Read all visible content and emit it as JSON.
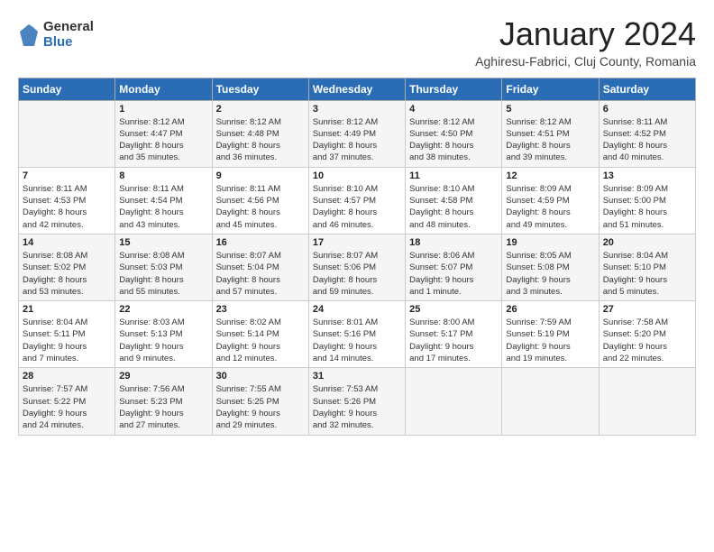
{
  "logo": {
    "general": "General",
    "blue": "Blue"
  },
  "title": "January 2024",
  "subtitle": "Aghiresu-Fabrici, Cluj County, Romania",
  "headers": [
    "Sunday",
    "Monday",
    "Tuesday",
    "Wednesday",
    "Thursday",
    "Friday",
    "Saturday"
  ],
  "weeks": [
    [
      {
        "day": "",
        "info": ""
      },
      {
        "day": "1",
        "info": "Sunrise: 8:12 AM\nSunset: 4:47 PM\nDaylight: 8 hours\nand 35 minutes."
      },
      {
        "day": "2",
        "info": "Sunrise: 8:12 AM\nSunset: 4:48 PM\nDaylight: 8 hours\nand 36 minutes."
      },
      {
        "day": "3",
        "info": "Sunrise: 8:12 AM\nSunset: 4:49 PM\nDaylight: 8 hours\nand 37 minutes."
      },
      {
        "day": "4",
        "info": "Sunrise: 8:12 AM\nSunset: 4:50 PM\nDaylight: 8 hours\nand 38 minutes."
      },
      {
        "day": "5",
        "info": "Sunrise: 8:12 AM\nSunset: 4:51 PM\nDaylight: 8 hours\nand 39 minutes."
      },
      {
        "day": "6",
        "info": "Sunrise: 8:11 AM\nSunset: 4:52 PM\nDaylight: 8 hours\nand 40 minutes."
      }
    ],
    [
      {
        "day": "7",
        "info": "Sunrise: 8:11 AM\nSunset: 4:53 PM\nDaylight: 8 hours\nand 42 minutes."
      },
      {
        "day": "8",
        "info": "Sunrise: 8:11 AM\nSunset: 4:54 PM\nDaylight: 8 hours\nand 43 minutes."
      },
      {
        "day": "9",
        "info": "Sunrise: 8:11 AM\nSunset: 4:56 PM\nDaylight: 8 hours\nand 45 minutes."
      },
      {
        "day": "10",
        "info": "Sunrise: 8:10 AM\nSunset: 4:57 PM\nDaylight: 8 hours\nand 46 minutes."
      },
      {
        "day": "11",
        "info": "Sunrise: 8:10 AM\nSunset: 4:58 PM\nDaylight: 8 hours\nand 48 minutes."
      },
      {
        "day": "12",
        "info": "Sunrise: 8:09 AM\nSunset: 4:59 PM\nDaylight: 8 hours\nand 49 minutes."
      },
      {
        "day": "13",
        "info": "Sunrise: 8:09 AM\nSunset: 5:00 PM\nDaylight: 8 hours\nand 51 minutes."
      }
    ],
    [
      {
        "day": "14",
        "info": "Sunrise: 8:08 AM\nSunset: 5:02 PM\nDaylight: 8 hours\nand 53 minutes."
      },
      {
        "day": "15",
        "info": "Sunrise: 8:08 AM\nSunset: 5:03 PM\nDaylight: 8 hours\nand 55 minutes."
      },
      {
        "day": "16",
        "info": "Sunrise: 8:07 AM\nSunset: 5:04 PM\nDaylight: 8 hours\nand 57 minutes."
      },
      {
        "day": "17",
        "info": "Sunrise: 8:07 AM\nSunset: 5:06 PM\nDaylight: 8 hours\nand 59 minutes."
      },
      {
        "day": "18",
        "info": "Sunrise: 8:06 AM\nSunset: 5:07 PM\nDaylight: 9 hours\nand 1 minute."
      },
      {
        "day": "19",
        "info": "Sunrise: 8:05 AM\nSunset: 5:08 PM\nDaylight: 9 hours\nand 3 minutes."
      },
      {
        "day": "20",
        "info": "Sunrise: 8:04 AM\nSunset: 5:10 PM\nDaylight: 9 hours\nand 5 minutes."
      }
    ],
    [
      {
        "day": "21",
        "info": "Sunrise: 8:04 AM\nSunset: 5:11 PM\nDaylight: 9 hours\nand 7 minutes."
      },
      {
        "day": "22",
        "info": "Sunrise: 8:03 AM\nSunset: 5:13 PM\nDaylight: 9 hours\nand 9 minutes."
      },
      {
        "day": "23",
        "info": "Sunrise: 8:02 AM\nSunset: 5:14 PM\nDaylight: 9 hours\nand 12 minutes."
      },
      {
        "day": "24",
        "info": "Sunrise: 8:01 AM\nSunset: 5:16 PM\nDaylight: 9 hours\nand 14 minutes."
      },
      {
        "day": "25",
        "info": "Sunrise: 8:00 AM\nSunset: 5:17 PM\nDaylight: 9 hours\nand 17 minutes."
      },
      {
        "day": "26",
        "info": "Sunrise: 7:59 AM\nSunset: 5:19 PM\nDaylight: 9 hours\nand 19 minutes."
      },
      {
        "day": "27",
        "info": "Sunrise: 7:58 AM\nSunset: 5:20 PM\nDaylight: 9 hours\nand 22 minutes."
      }
    ],
    [
      {
        "day": "28",
        "info": "Sunrise: 7:57 AM\nSunset: 5:22 PM\nDaylight: 9 hours\nand 24 minutes."
      },
      {
        "day": "29",
        "info": "Sunrise: 7:56 AM\nSunset: 5:23 PM\nDaylight: 9 hours\nand 27 minutes."
      },
      {
        "day": "30",
        "info": "Sunrise: 7:55 AM\nSunset: 5:25 PM\nDaylight: 9 hours\nand 29 minutes."
      },
      {
        "day": "31",
        "info": "Sunrise: 7:53 AM\nSunset: 5:26 PM\nDaylight: 9 hours\nand 32 minutes."
      },
      {
        "day": "",
        "info": ""
      },
      {
        "day": "",
        "info": ""
      },
      {
        "day": "",
        "info": ""
      }
    ]
  ]
}
